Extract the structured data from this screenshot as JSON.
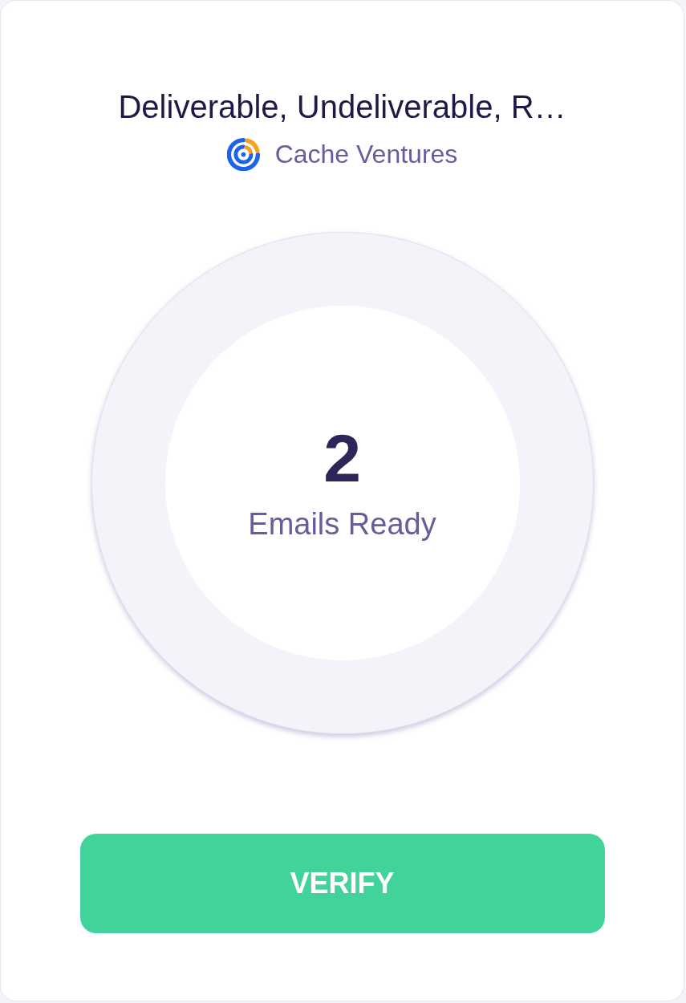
{
  "card": {
    "title": "Deliverable, Undeliverable, R…",
    "source": {
      "name": "Cache Ventures"
    }
  },
  "counter": {
    "value": "2",
    "label": "Emails Ready"
  },
  "button": {
    "label": "VERIFY"
  }
}
